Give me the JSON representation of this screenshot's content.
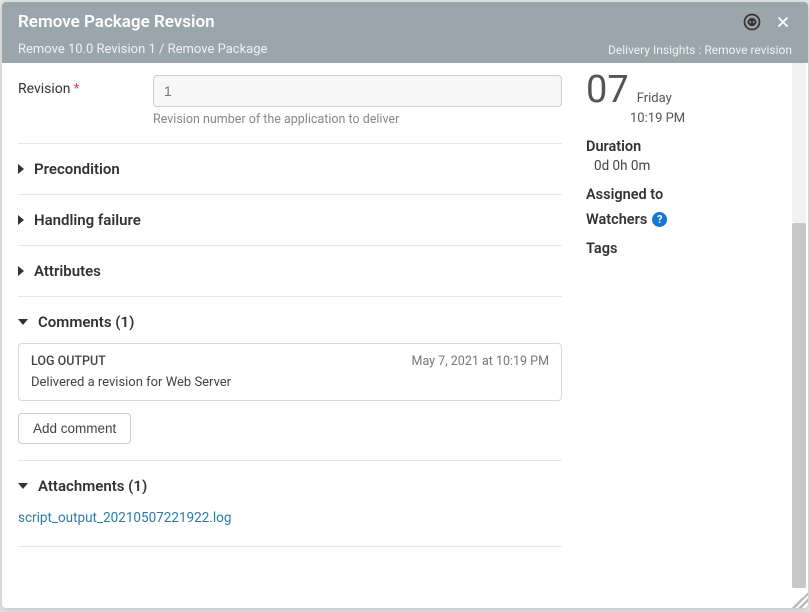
{
  "header": {
    "title": "Remove Package Revsion",
    "breadcrumb": "Remove 10.0 Revision 1 / Remove Package",
    "context": "Delivery Insights : Remove revision"
  },
  "form": {
    "revision": {
      "label": "Revision",
      "value": "1",
      "help": "Revision number of the application to deliver"
    }
  },
  "sections": {
    "precondition": {
      "title": "Precondition"
    },
    "handling_failure": {
      "title": "Handling failure"
    },
    "attributes": {
      "title": "Attributes"
    },
    "comments": {
      "title": "Comments (1)",
      "items": [
        {
          "author": "LOG OUTPUT",
          "time": "May 7, 2021 at 10:19 PM",
          "text": "Delivered a revision for Web Server"
        }
      ],
      "add_label": "Add comment"
    },
    "attachments": {
      "title": "Attachments (1)",
      "items": [
        {
          "name": "script_output_20210507221922.log"
        }
      ]
    }
  },
  "sidebar": {
    "day": "07",
    "weekday": "Friday",
    "time": "10:19 PM",
    "duration_label": "Duration",
    "duration_value": "0d 0h 0m",
    "assigned_label": "Assigned to",
    "watchers_label": "Watchers",
    "tags_label": "Tags"
  }
}
